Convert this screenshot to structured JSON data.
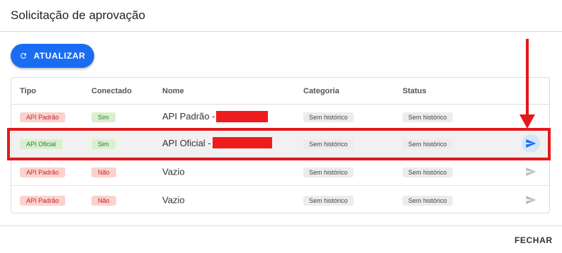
{
  "dialog": {
    "title": "Solicitação de aprovação",
    "close_label": "FECHAR"
  },
  "toolbar": {
    "refresh_label": "ATUALIZAR",
    "refresh_icon": "refresh-icon",
    "accent_color": "#1a6df2"
  },
  "table": {
    "columns": [
      "Tipo",
      "Conectado",
      "Nome",
      "Categoria",
      "Status"
    ],
    "rows": [
      {
        "tipo": "API Padrão",
        "conectado": "Sim",
        "nome": "API Padrão -",
        "nome_redacted": true,
        "categoria": "Sem histórico",
        "status": "Sem histórico",
        "action_enabled": false
      },
      {
        "tipo": "API Oficial",
        "conectado": "Sim",
        "nome": "API Oficial -",
        "nome_redacted": true,
        "categoria": "Sem histórico",
        "status": "Sem histórico",
        "action_enabled": true
      },
      {
        "tipo": "API Padrão",
        "conectado": "Não",
        "nome": "Vazio",
        "nome_redacted": false,
        "categoria": "Sem histórico",
        "status": "Sem histórico",
        "action_enabled": false
      },
      {
        "tipo": "API Padrão",
        "conectado": "Não",
        "nome": "Vazio",
        "nome_redacted": false,
        "categoria": "Sem histórico",
        "status": "Sem histórico",
        "action_enabled": false
      }
    ],
    "action_icon": "send-icon"
  },
  "annotation": {
    "highlight_color": "#e3191c",
    "highlighted_row_index": 1
  }
}
